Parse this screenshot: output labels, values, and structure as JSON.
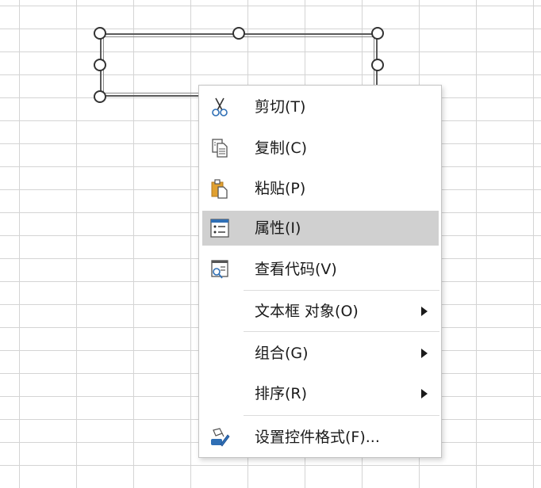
{
  "context_menu": {
    "items": [
      {
        "id": "cut",
        "label": "剪切(T)",
        "icon": "scissors-icon"
      },
      {
        "id": "copy",
        "label": "复制(C)",
        "icon": "copy-icon"
      },
      {
        "id": "paste",
        "label": "粘贴(P)",
        "icon": "paste-icon"
      },
      {
        "id": "properties",
        "label": "属性(I)",
        "icon": "properties-icon",
        "highlighted": true
      },
      {
        "id": "view-code",
        "label": "查看代码(V)",
        "icon": "view-code-icon"
      },
      {
        "id": "textbox-object",
        "label": "文本框 对象(O)",
        "submenu": true
      },
      {
        "id": "group",
        "label": "组合(G)",
        "submenu": true
      },
      {
        "id": "order",
        "label": "排序(R)",
        "submenu": true
      },
      {
        "id": "format-control",
        "label": "设置控件格式(F)...",
        "icon": "format-control-icon"
      }
    ]
  },
  "colors": {
    "highlight": "#d0d0d0",
    "icon_blue": "#2f6fb5",
    "icon_orange": "#e0a030"
  }
}
